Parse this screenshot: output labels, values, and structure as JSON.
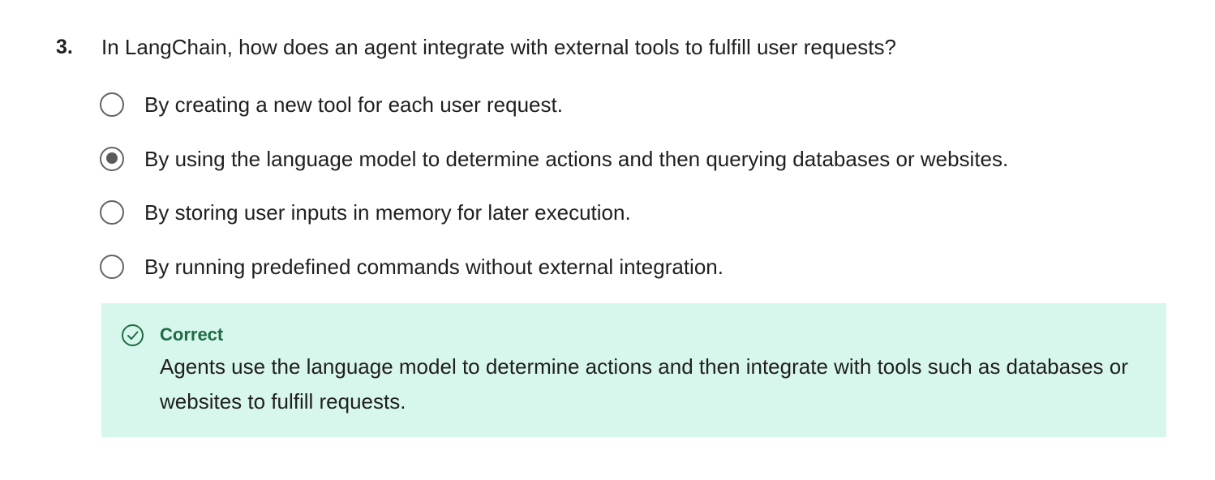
{
  "question": {
    "number": "3.",
    "text": "In LangChain, how does an agent integrate with external tools to fulfill user requests?",
    "options": [
      {
        "label": "By creating a new tool for each user request.",
        "selected": false
      },
      {
        "label": "By using the language model to determine actions and then querying databases or websites.",
        "selected": true
      },
      {
        "label": "By storing user inputs in memory for later execution.",
        "selected": false
      },
      {
        "label": "By running predefined commands without external integration.",
        "selected": false
      }
    ]
  },
  "feedback": {
    "icon": "check-circle-icon",
    "status": "Correct",
    "text": "Agents use the language model to determine actions and then integrate with tools such as databases or websites to fulfill requests.",
    "accent_color": "#1e6b45",
    "background_color": "#d8f7ec"
  }
}
